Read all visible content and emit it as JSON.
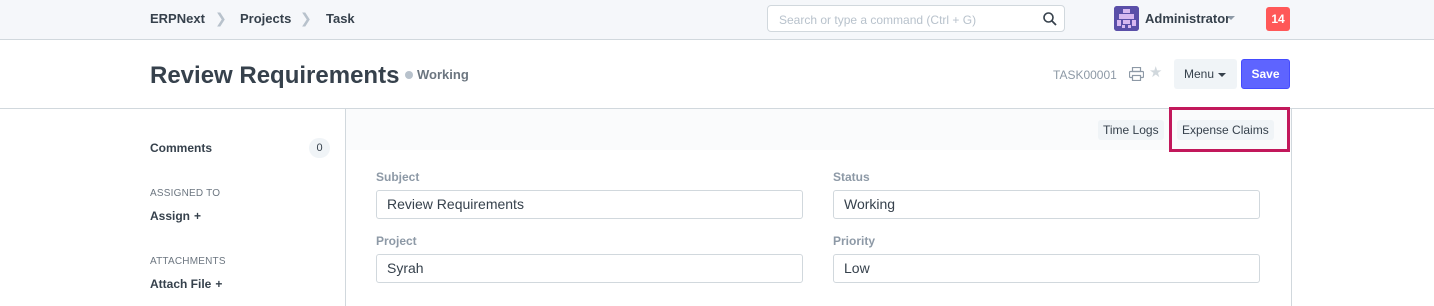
{
  "navbar": {
    "breadcrumbs": [
      "ERPNext",
      "Projects",
      "Task"
    ],
    "search_placeholder": "Search or type a command (Ctrl + G)",
    "user_name": "Administrator",
    "notification_count": "14"
  },
  "page_head": {
    "title": "Review Requirements",
    "status": "Working",
    "doc_id": "TASK00001",
    "menu_label": "Menu",
    "save_label": "Save"
  },
  "sidebar": {
    "comments_label": "Comments",
    "comments_count": "0",
    "assigned_to_heading": "ASSIGNED TO",
    "assign_label": "Assign",
    "attachments_heading": "ATTACHMENTS",
    "attach_label": "Attach File",
    "plus": "+"
  },
  "dashboard": {
    "links": [
      "Time Logs",
      "Expense Claims"
    ]
  },
  "form": {
    "subject_label": "Subject",
    "subject_value": "Review Requirements",
    "status_label": "Status",
    "status_value": "Working",
    "project_label": "Project",
    "project_value": "Syrah",
    "priority_label": "Priority",
    "priority_value": "Low"
  },
  "colors": {
    "primary": "#5e64ff",
    "notification": "#ff5858",
    "highlight": "#c2185b"
  }
}
